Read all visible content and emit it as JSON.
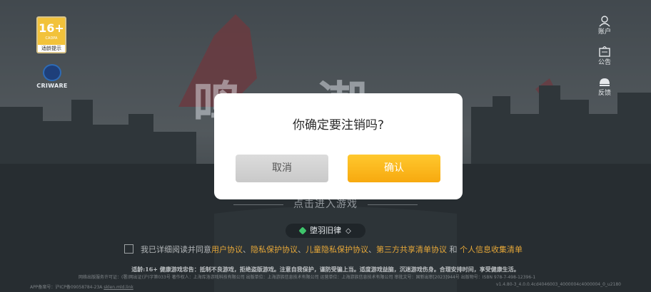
{
  "age_rating": {
    "label": "16+",
    "code": "CADPA",
    "tip": "适龄提示"
  },
  "criware": {
    "name": "CRIWARE"
  },
  "side_menu": [
    {
      "label": "账户"
    },
    {
      "label": "公告"
    },
    {
      "label": "反馈"
    }
  ],
  "logo_text": "鸣 潮",
  "enter_game": "点击进入游戏",
  "server": {
    "name": "堕羽旧律",
    "switch_icon": "◇"
  },
  "agreement": {
    "prefix": "我已详细阅读并同意",
    "links": [
      "用户协议",
      "隐私保护协议",
      "儿童隐私保护协议",
      "第三方共享清单协议"
    ],
    "separator": "、",
    "conjunction": "和",
    "last_link": "个人信息收集清单"
  },
  "health_advice": "适龄:16+  健康游戏忠告：抵制不良游戏，拒绝盗版游戏。注意自我保护，谨防受骗上当。适度游戏益脑，沉迷游戏伤身。合理安排时间，享受健康生活。",
  "license_text": "网络出版服务许可证：(署)网出证(沪)字第033号  著作权人：上海库洛游戏科技有限公司  出版单位：上海游族信息技术有限公司  运营单位：上海游族信息技术有限公司  审批文号：国新出审[2023]944号  出版物号：ISBN 978-7-498-12396-1",
  "app_record": "APP备案号：沪ICP备09058784-23A  ",
  "app_link": "sklen.mld.link",
  "version": "v1.4.80-3_4.0.0.4cd4046003_4000004c4000004_0_u2180",
  "dialog": {
    "question": "你确定要注销吗?",
    "cancel_label": "取消",
    "confirm_label": "确认"
  },
  "colors": {
    "confirm": "#f7a90f",
    "link": "#e7a838",
    "server_dot": "#3ec46b"
  }
}
